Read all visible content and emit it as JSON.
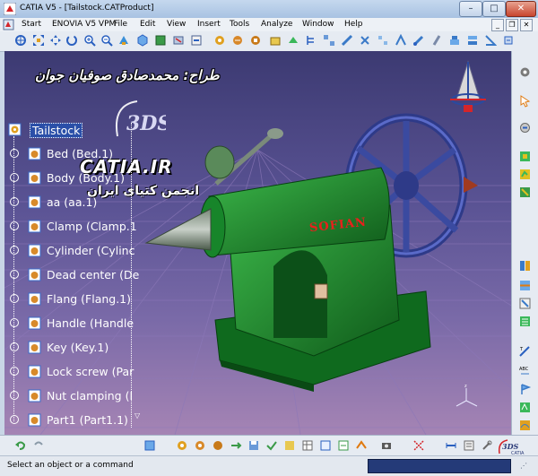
{
  "window": {
    "title": "CATIA V5 - [Tailstock.CATProduct]",
    "minimize": "–",
    "maximize": "□",
    "close": "✕"
  },
  "menu": {
    "items": [
      "Start",
      "ENOVIA V5 VPM",
      "File",
      "Edit",
      "View",
      "Insert",
      "Tools",
      "Analyze",
      "Window",
      "Help"
    ]
  },
  "viewport": {
    "designer_credit": "طراح: محمدصادق صوفیان جوان",
    "watermark_site": "CATIA.IR",
    "watermark_subtitle": "انجمن کتیای ایران",
    "part_brand": "SOFIAN"
  },
  "tree": {
    "root": "Tailstock",
    "items": [
      "Bed (Bed.1)",
      "Body (Body.1)",
      "aa (aa.1)",
      "Clamp (Clamp.1",
      "Cylinder (Cylinc",
      "Dead center (De",
      "Flang (Flang.1)",
      "Handle (Handle",
      "Key (Key.1)",
      "Lock screw (Par",
      "Nut clamping (I",
      "Part1 (Part1.1)"
    ]
  },
  "status": {
    "message": "Select an object or a command",
    "command_value": ""
  },
  "colors": {
    "model_green": "#1f8a2c",
    "brand_red": "#e8201c",
    "wheel_blue": "#3a4aa0",
    "background_top": "#3c3a72",
    "background_bottom": "#a584b4"
  }
}
